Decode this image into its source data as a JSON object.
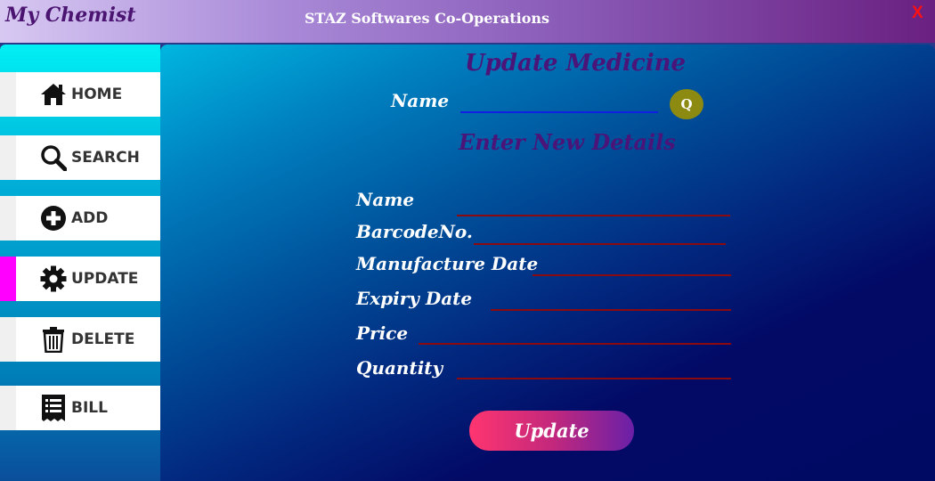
{
  "window": {
    "app_title": "My Chemist",
    "company": "STAZ Softwares Co-Operations",
    "close_label": "X"
  },
  "sidebar": {
    "items": [
      {
        "label": "HOME",
        "icon": "home-icon"
      },
      {
        "label": "SEARCH",
        "icon": "search-icon"
      },
      {
        "label": "ADD",
        "icon": "plus-circle-icon"
      },
      {
        "label": "UPDATE",
        "icon": "gear-icon",
        "active": true
      },
      {
        "label": "DELETE",
        "icon": "trash-icon"
      },
      {
        "label": "BILL",
        "icon": "receipt-icon"
      }
    ]
  },
  "main": {
    "title": "Update Medicine",
    "search": {
      "label": "Name",
      "value": "",
      "button_label": "Q"
    },
    "subtitle": "Enter New  Details",
    "fields": [
      {
        "label": "Name",
        "value": ""
      },
      {
        "label": "BarcodeNo.",
        "value": ""
      },
      {
        "label": "Manufacture Date",
        "value": ""
      },
      {
        "label": "Expiry Date",
        "value": ""
      },
      {
        "label": "Price",
        "value": ""
      },
      {
        "label": "Quantity",
        "value": ""
      }
    ],
    "submit_label": "Update"
  },
  "colors": {
    "accent_active": "#ff00ff",
    "field_underline": "#8a0a10",
    "search_underline": "#1020e0",
    "title_text": "#4a1478",
    "close_x": "#ff1010"
  }
}
